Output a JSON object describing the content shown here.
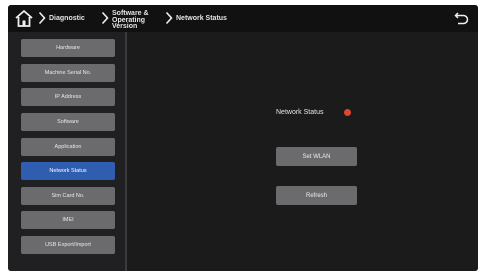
{
  "header": {
    "home_icon": "home-icon",
    "breadcrumbs": [
      "Diagnostic",
      "Software & Operating Version",
      "Network Status"
    ],
    "back_icon": "back-icon"
  },
  "sidebar": {
    "items": [
      {
        "label": "Hardware",
        "active": false
      },
      {
        "label": "Machine Serial No.",
        "active": false
      },
      {
        "label": "IP Address",
        "active": false
      },
      {
        "label": "Software",
        "active": false
      },
      {
        "label": "Application",
        "active": false
      },
      {
        "label": "Network Status",
        "active": true
      },
      {
        "label": "Sim Card No.",
        "active": false
      },
      {
        "label": "IMEI",
        "active": false
      },
      {
        "label": "USB Export/Import",
        "active": false
      }
    ]
  },
  "main": {
    "status_label": "Network Status",
    "status_color": "#e2452f",
    "set_wlan_label": "Set WLAN",
    "refresh_label": "Refresh"
  },
  "colors": {
    "active_item": "#2f5eb0",
    "button": "#6b6b6d",
    "background": "#1b1b1c"
  }
}
